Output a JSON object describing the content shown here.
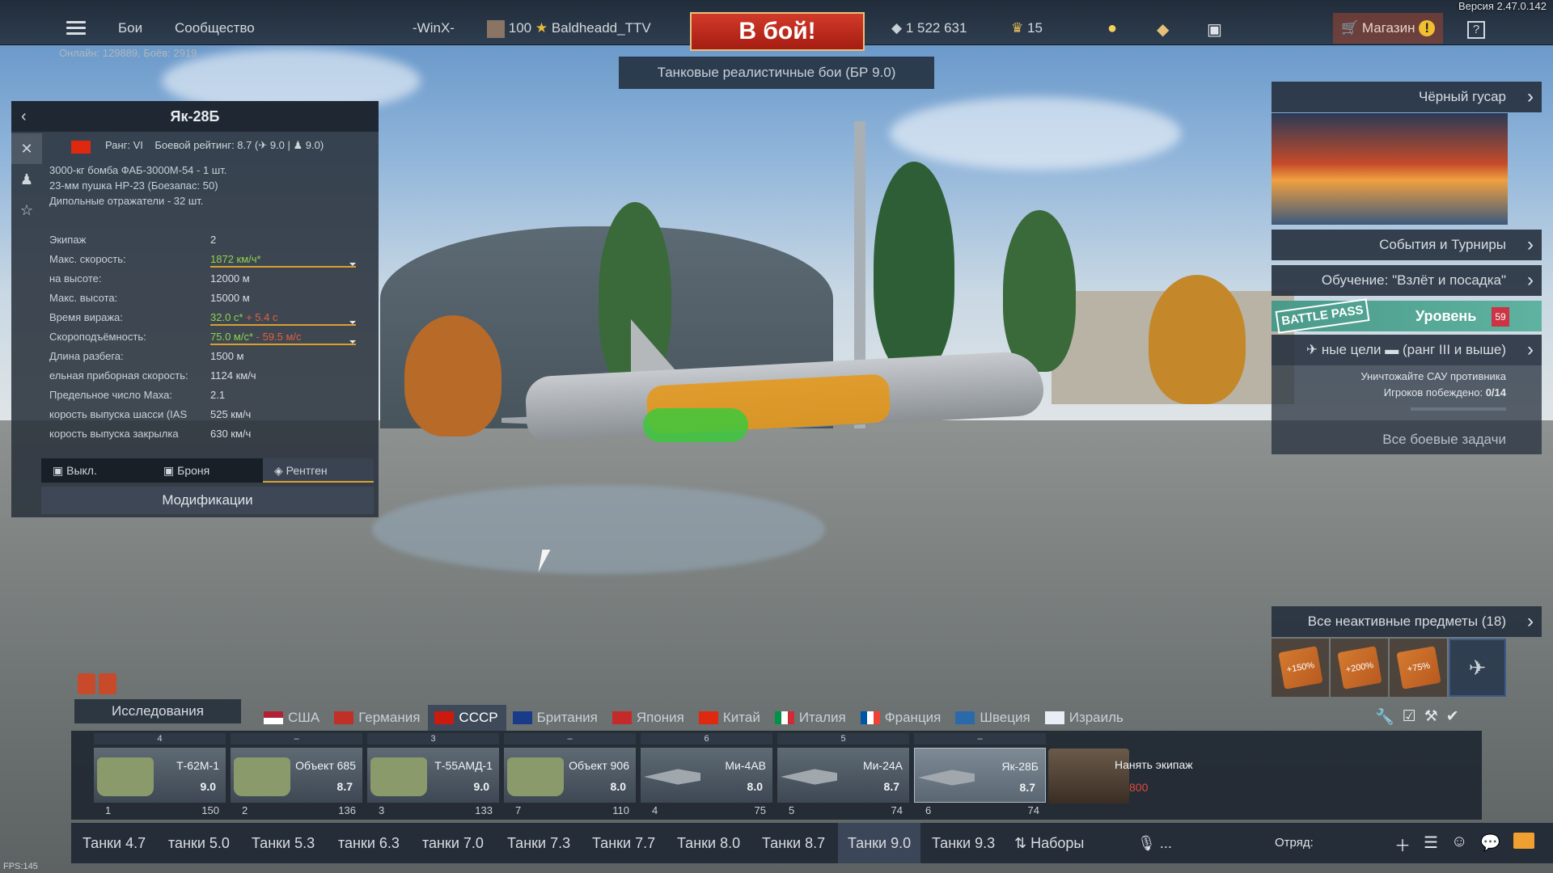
{
  "app": {
    "version": "Версия 2.47.0.142",
    "fps": "FPS:145"
  },
  "topbar": {
    "battles": "Бои",
    "community": "Сообщество",
    "squad_tag": "-WinX-",
    "level": "100",
    "username": "Baldheadd_TTV",
    "to_battle": "В бой!",
    "mode": "Танковые реалистичные бои (БР 9.0)",
    "silver": "1 522 631",
    "gold": "15",
    "shop": "Магазин",
    "help": "?",
    "online": "Онлайн: 129889, Боёв: 2919"
  },
  "vehicle_panel": {
    "name": "Як-28Б",
    "rank_label": "Ранг: VI",
    "br_label": "Боевой рейтинг: 8.7 (",
    "br_rest": " 9.0 | ",
    "br_end": " 9.0)",
    "armament": [
      "3000-кг бомба ФАБ-3000М-54 - 1 шт.",
      "23-мм пушка НР-23 (Боезапас: 50)",
      "Дипольные отражатели - 32 шт."
    ],
    "stats": [
      {
        "k": "Экипаж",
        "v": "2"
      },
      {
        "k": "Макс. скорость:",
        "v": "1872 км/ч*"
      },
      {
        "k": "на высоте:",
        "v": "12000 м"
      },
      {
        "k": "Макс. высота:",
        "v": "15000 м"
      },
      {
        "k": "Время виража:",
        "v": "32.0 с*",
        "v2": " + 5.4 с"
      },
      {
        "k": "Скороподъёмность:",
        "v": "75.0 м/с*",
        "v2": " - 59.5 м/с"
      },
      {
        "k": "Длина разбега:",
        "v": "1500 м"
      },
      {
        "k": "ельная приборная скорость:",
        "v": "1124 км/ч"
      },
      {
        "k": "Предельное число Маха:",
        "v": "2.1"
      },
      {
        "k": "корость выпуска шасси (IAS",
        "v": "525 км/ч"
      },
      {
        "k": "корость выпуска закрылка",
        "v": "630 км/ч"
      }
    ],
    "view_tabs": [
      "Выкл.",
      "Броня",
      "Рентген"
    ],
    "modifications": "Модификации"
  },
  "right_panel": {
    "promo_title": "Чёрный гусар",
    "events": "События и Турниры",
    "tutorial": "Обучение: \"Взлёт и посадка\"",
    "battlepass_logo": "BATTLE PASS",
    "battlepass_level": "Уровень",
    "battlepass_badge": "59",
    "task_title": "ные цели",
    "task_rank": "(ранг III и выше)",
    "task_desc": "Уничтожайте САУ противника",
    "task_progress_label": "Игроков побеждено: ",
    "task_progress_value": "0/14",
    "task_progress_fraction": 0,
    "all_tasks": "Все боевые задачи",
    "inactive_items": "Все неактивные предметы (18)",
    "item_cards": [
      "+150%",
      "+200%",
      "+75%"
    ]
  },
  "bottom": {
    "research": "Исследования",
    "nations": [
      "США",
      "Германия",
      "СССР",
      "Британия",
      "Япония",
      "Китай",
      "Италия",
      "Франция",
      "Швеция",
      "Израиль"
    ],
    "active_nation_index": 2,
    "slots": [
      {
        "head": "4",
        "name": "Т-62М-1",
        "br": "9.0",
        "num": "1",
        "cost": "150"
      },
      {
        "head": "–",
        "name": "Объект 685",
        "br": "8.7",
        "num": "2",
        "cost": "136"
      },
      {
        "head": "3",
        "name": "Т-55АМД-1",
        "br": "9.0",
        "num": "3",
        "cost": "133"
      },
      {
        "head": "–",
        "name": "Объект 906",
        "br": "8.0",
        "num": "7",
        "cost": "110"
      },
      {
        "head": "6",
        "name": "Ми-4АВ",
        "br": "8.0",
        "num": "4",
        "cost": "75"
      },
      {
        "head": "5",
        "name": "Ми-24А",
        "br": "8.7",
        "num": "5",
        "cost": "74"
      },
      {
        "head": "–",
        "name": "Як-28Б",
        "br": "8.7",
        "num": "6",
        "cost": "74"
      }
    ],
    "crew": {
      "label": "Нанять экипаж",
      "price": "800"
    },
    "presets": [
      "Танки 4.7",
      "танки 5.0",
      "Танки 5.3",
      "танки 6.3",
      "танки 7.0",
      "Танки 7.3",
      "Танки 7.7",
      "Танки 8.0",
      "Танки 8.7",
      "Танки 9.0",
      "Танки 9.3"
    ],
    "active_preset_index": 9,
    "presets_btn": "Наборы",
    "voice": "...",
    "squad": "Отряд:"
  },
  "colors": {
    "accent_red": "#c42a1a",
    "positive_green": "#8fd34a",
    "negative_red": "#e06040",
    "bar_gold": "#d9a030"
  }
}
